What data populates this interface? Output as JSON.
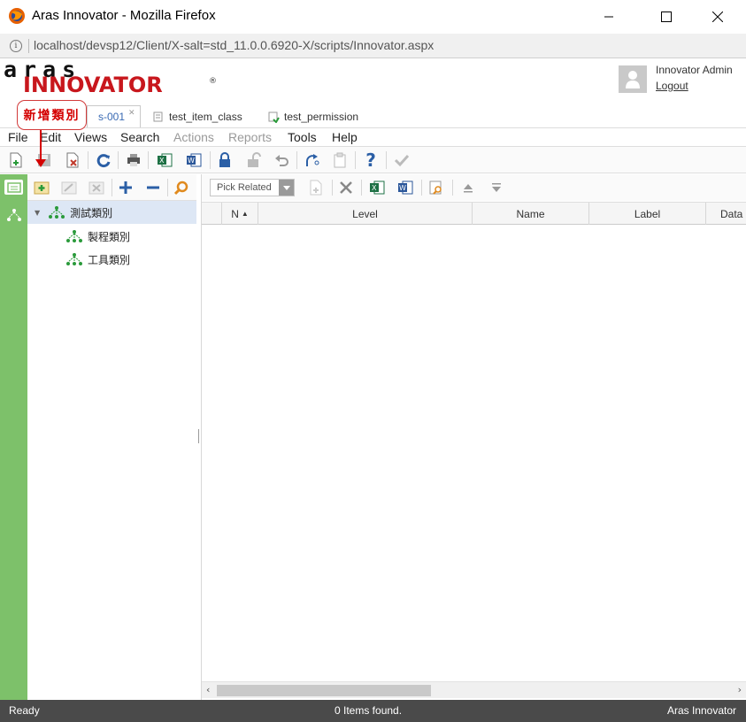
{
  "window": {
    "title": "Aras Innovator - Mozilla Firefox"
  },
  "address_bar": {
    "url": "localhost/devsp12/Client/X-salt=std_11.0.0.6920-X/scripts/Innovator.aspx"
  },
  "app": {
    "logo_top": "aras",
    "logo_bottom": "INNOVATOR",
    "logo_reg": "®",
    "user_name": "Innovator Admin",
    "logout_label": "Logout"
  },
  "tabs": [
    {
      "label": "s-001",
      "active": true
    },
    {
      "label": "test_item_class",
      "active": false
    },
    {
      "label": "test_permission",
      "active": false
    }
  ],
  "annotation": {
    "callout_text": "新增類別",
    "color": "#d40000"
  },
  "menu": [
    {
      "label": "File",
      "enabled": true
    },
    {
      "label": "Edit",
      "enabled": true
    },
    {
      "label": "Views",
      "enabled": true
    },
    {
      "label": "Search",
      "enabled": true
    },
    {
      "label": "Actions",
      "enabled": false
    },
    {
      "label": "Reports",
      "enabled": false
    },
    {
      "label": "Tools",
      "enabled": true
    },
    {
      "label": "Help",
      "enabled": true
    }
  ],
  "toolbar_icons": [
    "new-item-icon",
    "save-icon",
    "delete-icon",
    "refresh-icon",
    "print-icon",
    "excel-icon",
    "word-icon",
    "lock-icon",
    "unlock-icon",
    "undo-icon",
    "promote-icon",
    "clipboard-icon",
    "help-icon",
    "done-icon"
  ],
  "tree": {
    "tools": [
      "add-class-icon",
      "edit-class-icon",
      "remove-class-icon",
      "expand-all-icon",
      "collapse-all-icon",
      "search-icon"
    ],
    "nodes": [
      {
        "label": "測試類別",
        "level": 0,
        "expanded": true,
        "selected": true
      },
      {
        "label": "製程類別",
        "level": 1,
        "selected": false
      },
      {
        "label": "工具類別",
        "level": 1,
        "selected": false
      }
    ]
  },
  "relationships": {
    "pick_label": "Pick Related",
    "columns": [
      "N",
      "Level",
      "Name",
      "Label",
      "Data"
    ],
    "sort_indicator": "▲"
  },
  "status": {
    "left": "Ready",
    "center": "0 Items found.",
    "right": "Aras Innovator"
  },
  "colors": {
    "accent_green": "#7dc16a",
    "brand_red": "#c8171d",
    "status_bar": "#4a4a4a",
    "selection": "#dde7f5"
  }
}
